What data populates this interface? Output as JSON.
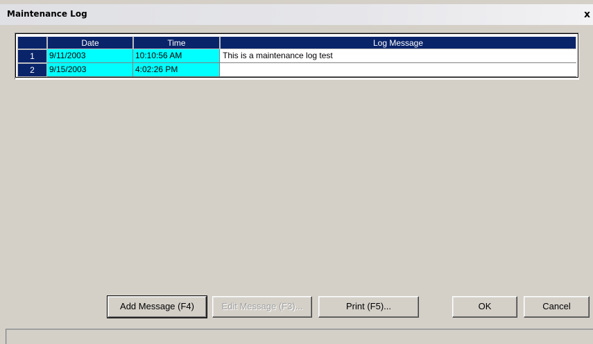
{
  "window": {
    "title": "Maintenance Log",
    "close_glyph": "x"
  },
  "grid": {
    "headers": [
      "",
      "Date",
      "Time",
      "Log Message"
    ],
    "rows": [
      {
        "num": "1",
        "date": "9/11/2003",
        "time": "10:10:56 AM",
        "message": "This is a maintenance log test"
      },
      {
        "num": "2",
        "date": "9/15/2003",
        "time": "4:02:26 PM",
        "message": ""
      }
    ]
  },
  "buttons": {
    "add": "Add Message (F4)",
    "edit": "Edit Message (F3)...",
    "print": "Print (F5)...",
    "ok": "OK",
    "cancel": "Cancel"
  },
  "colors": {
    "header_bg": "#0a246a",
    "highlight": "#00ffff",
    "dialog_bg": "#d4d0c8"
  }
}
